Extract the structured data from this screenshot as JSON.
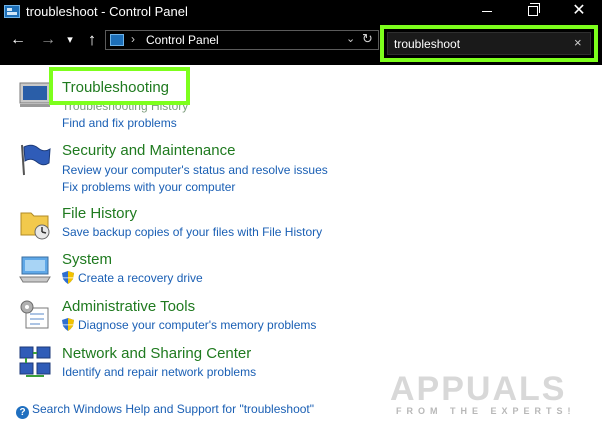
{
  "window": {
    "title": "troubleshoot - Control Panel",
    "minimize": "",
    "maximize": "",
    "close": "✕"
  },
  "nav": {
    "back": "←",
    "forward": "→",
    "recent": "▾",
    "up": "↑",
    "address_separator": "›",
    "address_location": "Control Panel",
    "address_dropdown": "⌄",
    "refresh": "↻"
  },
  "search": {
    "value": "troubleshoot",
    "clear": "×"
  },
  "results": [
    {
      "icon": "troubleshooting-icon",
      "title": "Troubleshooting",
      "links": [
        "Troubleshooting History",
        "Find and fix problems"
      ]
    },
    {
      "icon": "security-flag-icon",
      "title": "Security and Maintenance",
      "links": [
        "Review your computer's status and resolve issues",
        "Fix problems with your computer"
      ]
    },
    {
      "icon": "file-history-icon",
      "title": "File History",
      "links": [
        "Save backup copies of your files with File History"
      ]
    },
    {
      "icon": "system-icon",
      "title": "System",
      "links": [
        "Create a recovery drive"
      ]
    },
    {
      "icon": "admin-tools-icon",
      "title": "Administrative Tools",
      "links": [
        "Diagnose your computer's memory problems"
      ]
    },
    {
      "icon": "network-icon",
      "title": "Network and Sharing Center",
      "links": [
        "Identify and repair network problems"
      ]
    }
  ],
  "help": {
    "icon": "?",
    "text": "Search Windows Help and Support for \"troubleshoot\""
  },
  "watermark": {
    "main": "APPUALS",
    "sub": "FROM THE EXPERTS!"
  },
  "colors": {
    "title_green": "#1f7a1f",
    "link_blue": "#1a5fb4",
    "highlight": "#7dff1c",
    "chrome_bg": "#000000"
  }
}
